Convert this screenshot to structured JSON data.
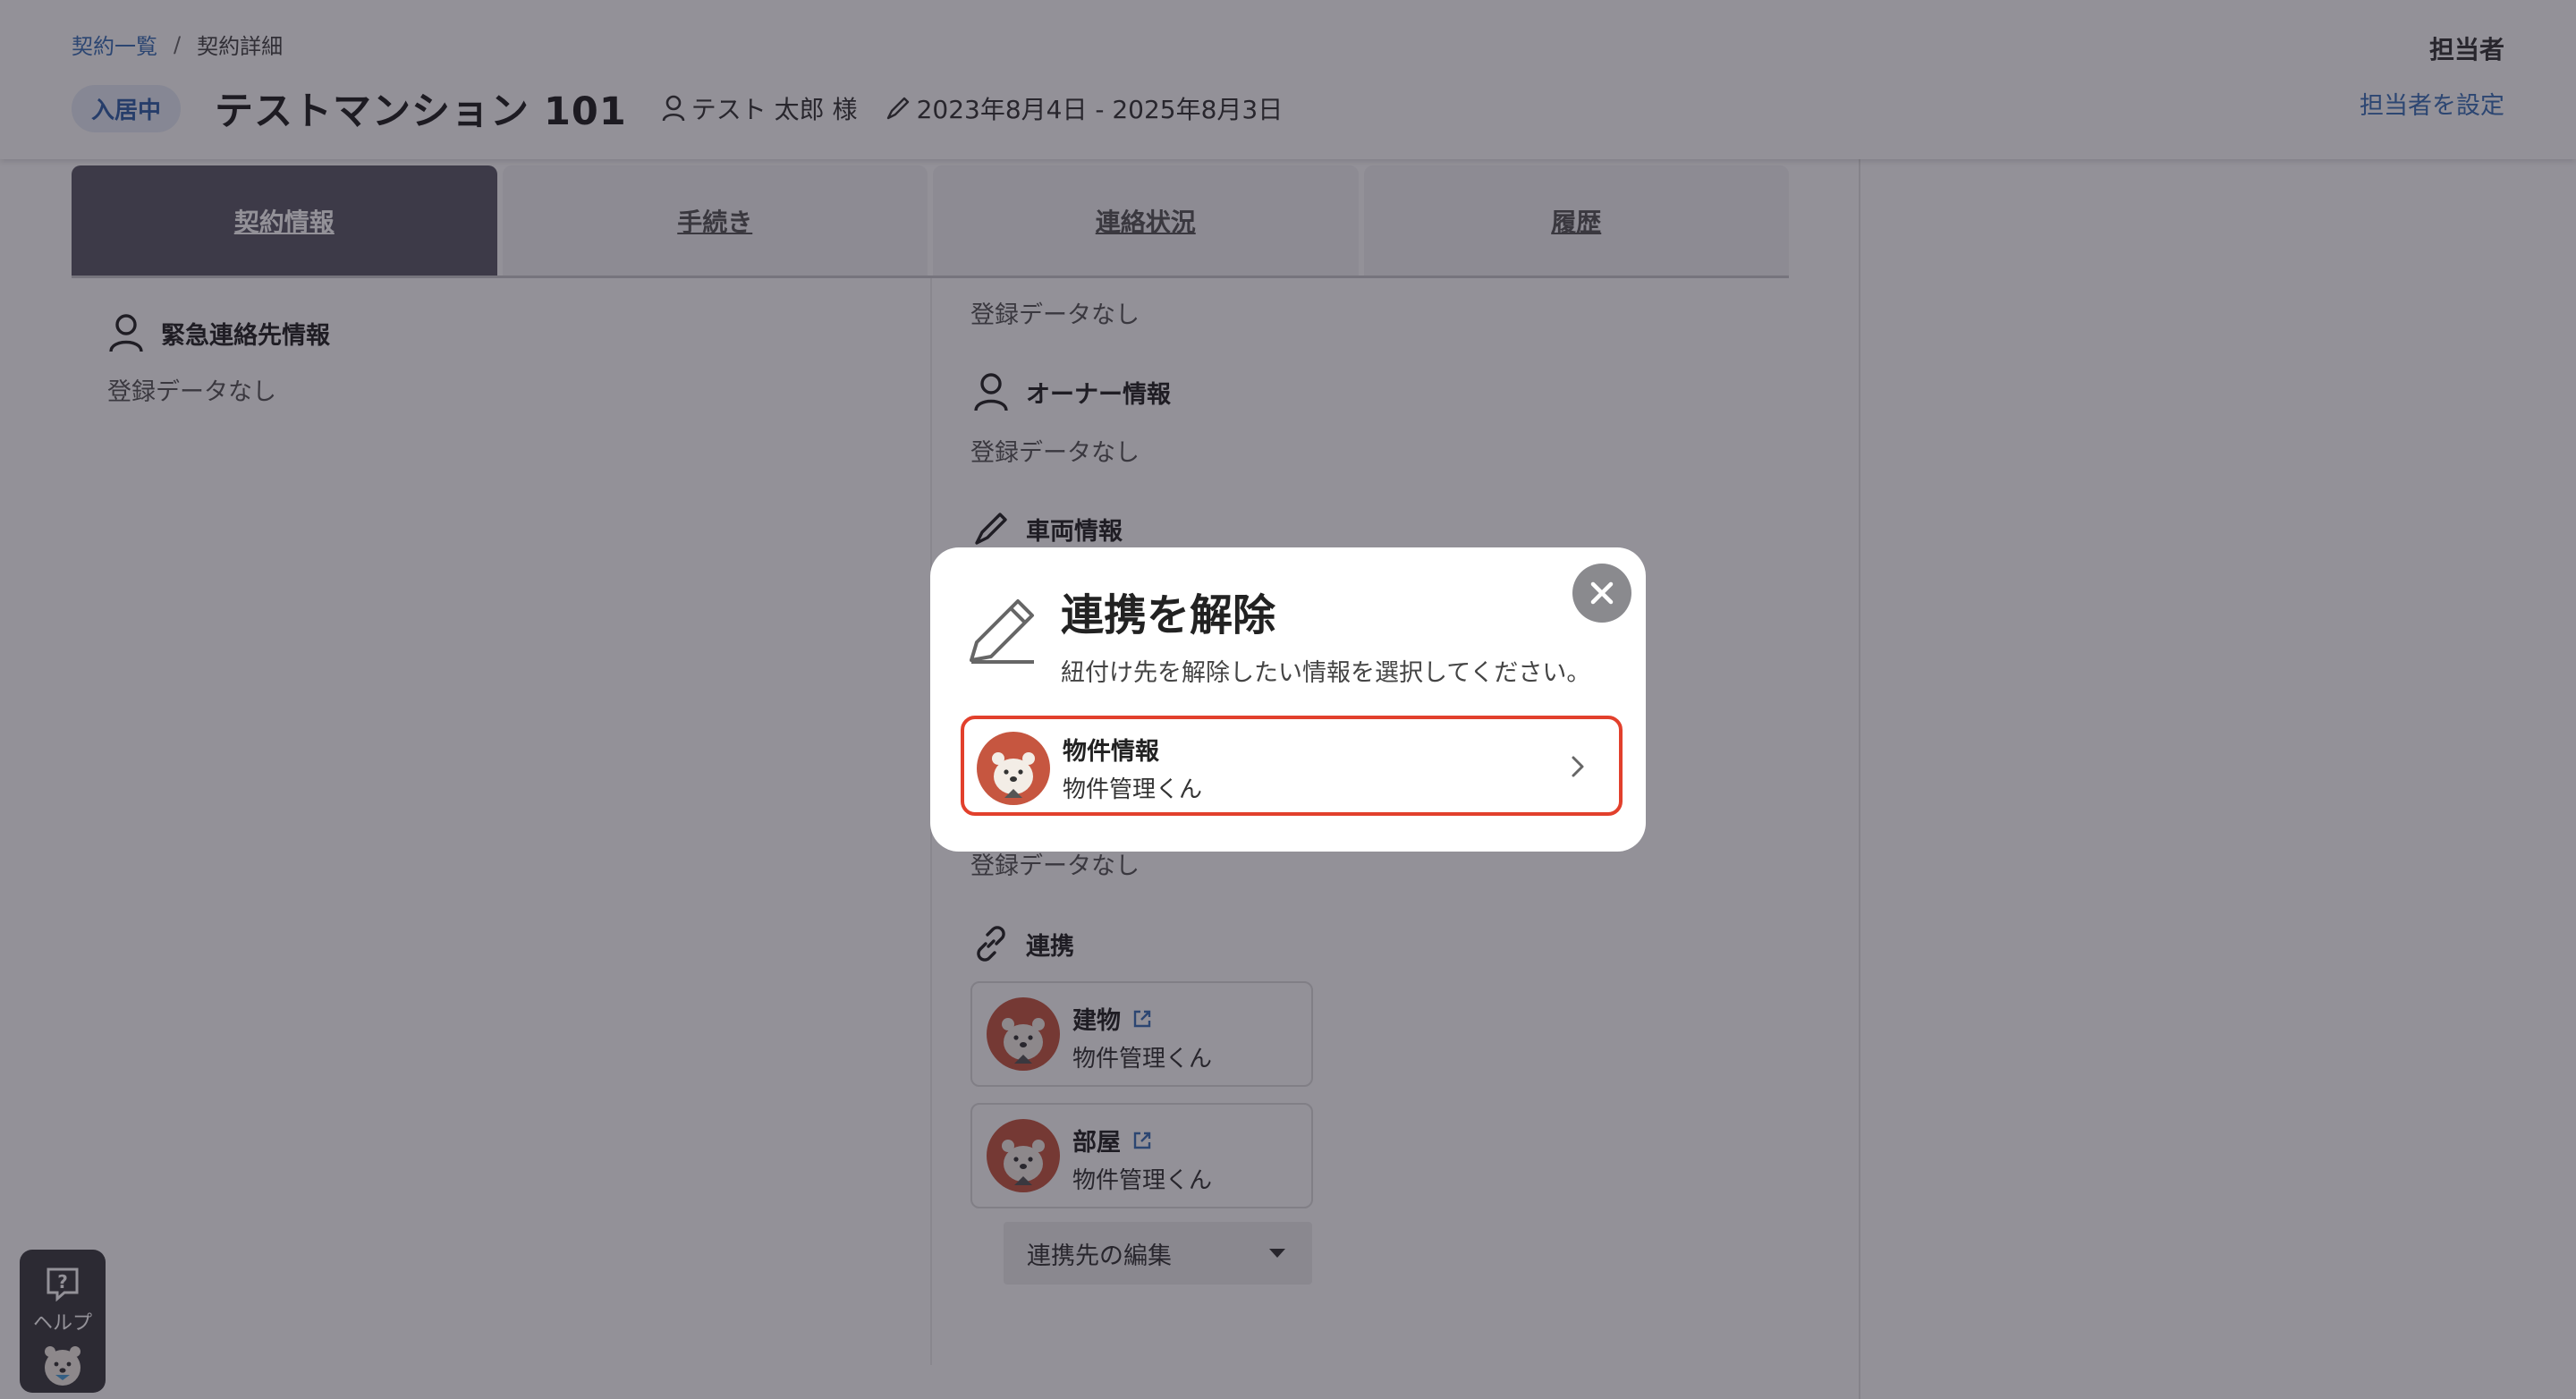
{
  "breadcrumb": {
    "parent": "契約一覧",
    "separator": "/",
    "current": "契約詳細"
  },
  "header": {
    "status": "入居中",
    "title": "テストマンション 101",
    "tenant": "テスト 太郎 様",
    "period": "2023年8月4日 - 2025年8月3日",
    "assignee_label": "担当者",
    "assignee_link": "担当者を設定"
  },
  "tabs": [
    {
      "label": "契約情報",
      "active": true
    },
    {
      "label": "手続き",
      "active": false
    },
    {
      "label": "連絡状況",
      "active": false
    },
    {
      "label": "履歴",
      "active": false
    }
  ],
  "left_column": {
    "emergency_title": "緊急連絡先情報",
    "emergency_empty": "登録データなし"
  },
  "right_column": {
    "top_empty": "登録データなし",
    "owner_title": "オーナー情報",
    "owner_empty": "登録データなし",
    "vehicle_title": "車両情報",
    "lower_empty": "登録データなし",
    "link_title": "連携",
    "link_cards": [
      {
        "title": "建物",
        "subtitle": "物件管理くん"
      },
      {
        "title": "部屋",
        "subtitle": "物件管理くん"
      }
    ],
    "edit_dropdown": "連携先の編集"
  },
  "help": {
    "label": "ヘルプ"
  },
  "modal": {
    "title": "連携を解除",
    "description": "紐付け先を解除したい情報を選択してください。",
    "option": {
      "title": "物件情報",
      "subtitle": "物件管理くん"
    }
  },
  "colors": {
    "accent": "#3a6fb7",
    "highlight_border": "#e2402c",
    "active_tab": "#5a5866",
    "avatar": "#c65640"
  },
  "icons": [
    "person-icon",
    "pen-icon",
    "link-icon",
    "external-link-icon",
    "close-icon",
    "chevron-right-icon",
    "help-icon",
    "bear-avatar-icon"
  ]
}
